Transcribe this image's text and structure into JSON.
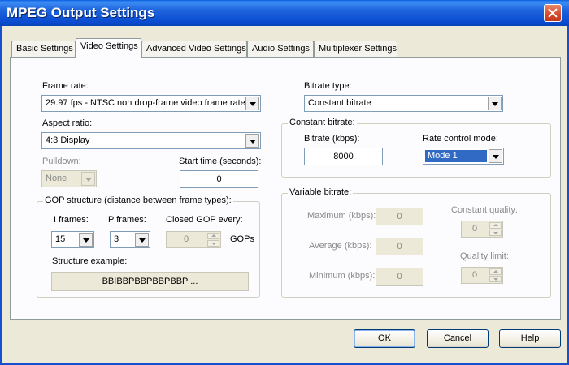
{
  "window": {
    "title": "MPEG Output Settings"
  },
  "tabs": [
    {
      "label": "Basic Settings"
    },
    {
      "label": "Video Settings"
    },
    {
      "label": "Advanced Video Settings"
    },
    {
      "label": "Audio Settings"
    },
    {
      "label": "Multiplexer Settings"
    }
  ],
  "left": {
    "frame_rate": {
      "label": "Frame rate:",
      "value": "29.97 fps - NTSC non drop-frame video frame rate"
    },
    "aspect_ratio": {
      "label": "Aspect ratio:",
      "value": "4:3 Display"
    },
    "pulldown": {
      "label": "Pulldown:",
      "value": "None"
    },
    "start_time": {
      "label": "Start time (seconds):",
      "value": "0"
    }
  },
  "gop": {
    "title": "GOP structure (distance between frame types):",
    "i_frames": {
      "label": "I frames:",
      "value": "15"
    },
    "p_frames": {
      "label": "P frames:",
      "value": "3"
    },
    "closed_gop": {
      "label": "Closed GOP every:",
      "value": "0",
      "unit": "GOPs"
    },
    "structure": {
      "label": "Structure example:",
      "value": "BBIBBPBBPBBPBBP ..."
    }
  },
  "right": {
    "bitrate_type": {
      "label": "Bitrate type:",
      "value": "Constant bitrate"
    },
    "constant": {
      "title": "Constant bitrate:",
      "bitrate_label": "Bitrate (kbps):",
      "bitrate_value": "8000",
      "rate_mode_label": "Rate control mode:",
      "rate_mode_value": "Mode 1"
    },
    "variable": {
      "title": "Variable bitrate:",
      "maximum_label": "Maximum (kbps):",
      "maximum_value": "0",
      "average_label": "Average (kbps):",
      "average_value": "0",
      "minimum_label": "Minimum (kbps):",
      "minimum_value": "0",
      "quality_label": "Constant quality:",
      "quality_value": "0",
      "quality_limit_label": "Quality limit:",
      "quality_limit_value": "0"
    }
  },
  "buttons": {
    "ok": "OK",
    "cancel": "Cancel",
    "help": "Help"
  }
}
